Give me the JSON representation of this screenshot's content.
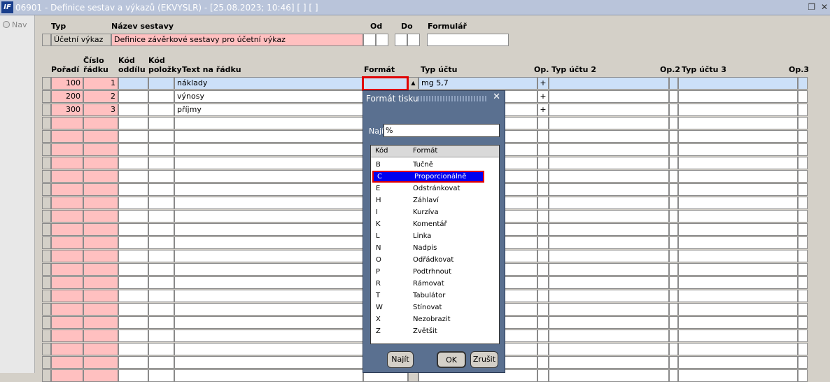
{
  "window": {
    "title": "06901 - Definice sestav a výkazů (EKVYSLR) - [25.08.2023; 10:46]  [ ]  [ ]",
    "app_icon": "IF",
    "restore_icon": "restore-icon",
    "close_icon": "close-icon"
  },
  "nav": {
    "label": "Nav"
  },
  "header": {
    "typ_label": "Typ",
    "nazev_label": "Název sestavy",
    "od_label": "Od",
    "do_label": "Do",
    "formular_label": "Formulář",
    "typ_value": "Účetní výkaz",
    "nazev_value": "Definice závěrkové sestavy pro účetní výkaz",
    "od_value": "",
    "do_value": "",
    "formular_value": ""
  },
  "columns": {
    "poradi": "Pořadí",
    "cislo_1": "Číslo",
    "cislo_2": "řádku",
    "kod_oddilu_1": "Kód",
    "kod_oddilu_2": "oddílu",
    "kod_polozky_1": "Kód",
    "kod_polozky_2": "položky",
    "text": "Text na řádku",
    "format": "Formát",
    "typ_uctu": "Typ účtu",
    "op": "Op.",
    "typ_uctu_2": "Typ účtu 2",
    "op2": "Op.2",
    "typ_uctu_3": "Typ účtu 3",
    "op3": "Op.3"
  },
  "rows": [
    {
      "poradi": "100",
      "cislo": "1",
      "text": "náklady",
      "format": "",
      "typ_uctu": "mg 5,7",
      "op": "+"
    },
    {
      "poradi": "200",
      "cislo": "2",
      "text": "výnosy",
      "format": "",
      "typ_uctu": "",
      "op": "+"
    },
    {
      "poradi": "300",
      "cislo": "3",
      "text": "příjmy",
      "format": "",
      "typ_uctu": "",
      "op": "+"
    }
  ],
  "popup": {
    "title": "Formát tisku",
    "find_label": "Najít",
    "find_value": "%",
    "col_kod": "Kód",
    "col_format": "Formát",
    "items": [
      {
        "k": "B",
        "v": "Tučně"
      },
      {
        "k": "C",
        "v": "Proporcionálně"
      },
      {
        "k": "E",
        "v": "Odstránkovat"
      },
      {
        "k": "H",
        "v": "Záhlaví"
      },
      {
        "k": "I",
        "v": "Kurzíva"
      },
      {
        "k": "K",
        "v": "Komentář"
      },
      {
        "k": "L",
        "v": "Linka"
      },
      {
        "k": "N",
        "v": "Nadpis"
      },
      {
        "k": "O",
        "v": "Odřádkovat"
      },
      {
        "k": "P",
        "v": "Podtrhnout"
      },
      {
        "k": "R",
        "v": "Rámovat"
      },
      {
        "k": "T",
        "v": "Tabulátor"
      },
      {
        "k": "W",
        "v": "Stínovat"
      },
      {
        "k": "X",
        "v": "Nezobrazit"
      },
      {
        "k": "Z",
        "v": "Zvětšit"
      }
    ],
    "selected_index": 1,
    "btn_find": "Najít",
    "btn_ok": "OK",
    "btn_cancel": "Zrušit"
  },
  "colors": {
    "title_bg": "#b9c4da",
    "required": "#ffc0c0",
    "current_row": "#cce0f8",
    "selection": "#0000f0",
    "highlight": "#e00000"
  }
}
